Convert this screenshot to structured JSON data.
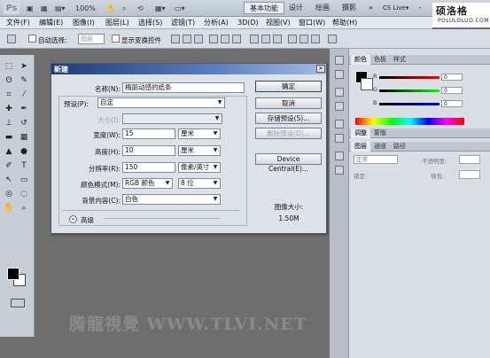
{
  "app": {
    "logo": "Ps",
    "zoom": "100%",
    "workspaces": [
      "基本功能",
      "设计",
      "绘画",
      "摄影"
    ],
    "more": "»",
    "cs_live": "CS Live▾",
    "window_controls": [
      "-",
      "□",
      "×"
    ]
  },
  "watermark": {
    "top_big": "硕洛格",
    "top_small": "POLULOLUO.COM",
    "bottom": "腾龍視覺 WWW.TLVI.NET"
  },
  "menu": [
    "文件(F)",
    "编辑(E)",
    "图像(I)",
    "图层(L)",
    "选择(S)",
    "滤镜(T)",
    "分析(A)",
    "3D(D)",
    "视图(V)",
    "窗口(W)",
    "帮助(H)"
  ],
  "options": {
    "auto_select": "自动选择:",
    "auto_select_value": "图层",
    "show_transform": "显示变换控件"
  },
  "panels": {
    "color_tabs": [
      "颜色",
      "色板",
      "样式"
    ],
    "rgb": [
      {
        "label": "R",
        "value": "0"
      },
      {
        "label": "G",
        "value": "0"
      },
      {
        "label": "B",
        "value": "0"
      }
    ],
    "adjust_tabs": [
      "调整",
      "蒙版"
    ],
    "layers_tabs": [
      "图层",
      "通道",
      "路径"
    ],
    "blend_mode": "正常",
    "opacity_label": "不透明度:",
    "lock_label": "锁定:",
    "fill_label": "填充:"
  },
  "dialog": {
    "title": "新建",
    "close": "×",
    "name_label": "名称(N):",
    "name_value": "梅丽动感的纸条",
    "preset_label": "预设(P):",
    "preset_value": "自定",
    "size_label": "大小(I):",
    "size_value": "",
    "width_label": "宽度(W):",
    "width_value": "15",
    "width_unit": "厘米",
    "height_label": "高度(H):",
    "height_value": "10",
    "height_unit": "厘米",
    "resolution_label": "分辨率(R):",
    "resolution_value": "150",
    "resolution_unit": "像素/英寸",
    "colormode_label": "颜色模式(M):",
    "colormode_value": "RGB 颜色",
    "bitdepth_value": "8 位",
    "bg_label": "背景内容(C):",
    "bg_value": "白色",
    "advanced_label": "高级",
    "buttons": {
      "ok": "确定",
      "cancel": "取消",
      "save_preset": "存储预设(S)...",
      "delete_preset": "删除预设(D)...",
      "device_central": "Device Central(E)..."
    },
    "image_size_label": "图像大小:",
    "image_size_value": "1.50M"
  },
  "colors": {
    "accent_title": "#1f3c75",
    "panel_bg": "#d9dee4",
    "canvas_bg": "#6e6e6e"
  }
}
